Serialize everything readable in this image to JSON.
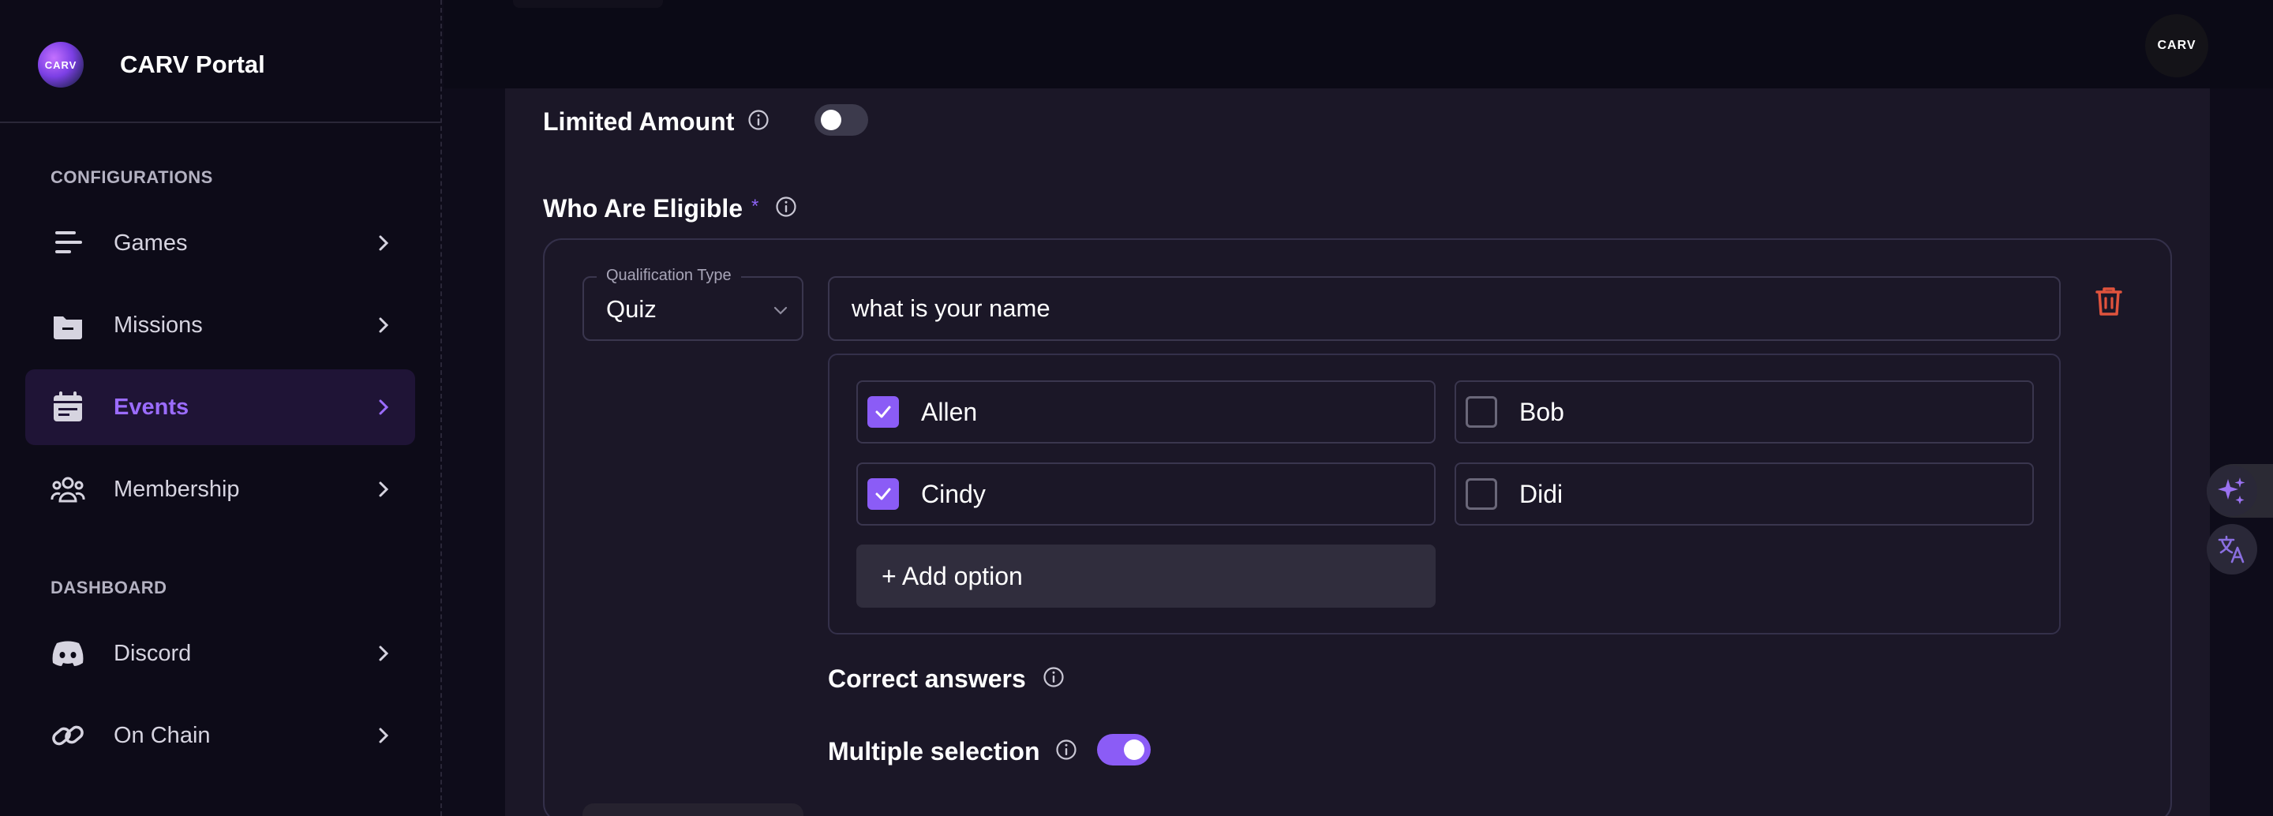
{
  "brand": {
    "title": "CARV Portal",
    "logo_text": "CARV"
  },
  "sidebar": {
    "sections": [
      {
        "label": "CONFIGURATIONS"
      },
      {
        "label": "DASHBOARD"
      }
    ],
    "items": [
      {
        "label": "Games",
        "icon": "games-icon",
        "active": false
      },
      {
        "label": "Missions",
        "icon": "missions-icon",
        "active": false
      },
      {
        "label": "Events",
        "icon": "events-calendar-icon",
        "active": true
      },
      {
        "label": "Membership",
        "icon": "membership-icon",
        "active": false
      },
      {
        "label": "Discord",
        "icon": "discord-icon",
        "active": false
      },
      {
        "label": "On Chain",
        "icon": "chain-link-icon",
        "active": false
      }
    ]
  },
  "header": {
    "avatar_text": "CARV"
  },
  "form": {
    "limited_amount": {
      "label": "Limited Amount",
      "enabled": false
    },
    "who_eligible": {
      "label": "Who Are Eligible",
      "required_mark": "*"
    },
    "qualification": {
      "type_label": "Qualification Type",
      "type_value": "Quiz",
      "question_value": "what is your name",
      "options": [
        {
          "label": "Allen",
          "checked": true
        },
        {
          "label": "Bob",
          "checked": false
        },
        {
          "label": "Cindy",
          "checked": true
        },
        {
          "label": "Didi",
          "checked": false
        }
      ],
      "add_option_label": "+ Add option",
      "correct_answers_label": "Correct answers",
      "multiple_selection": {
        "label": "Multiple selection",
        "enabled": true
      }
    }
  },
  "colors": {
    "accent": "#8b5cf6",
    "danger": "#e0533d",
    "background": "#0e0c1a",
    "panel": "#1b1727"
  }
}
